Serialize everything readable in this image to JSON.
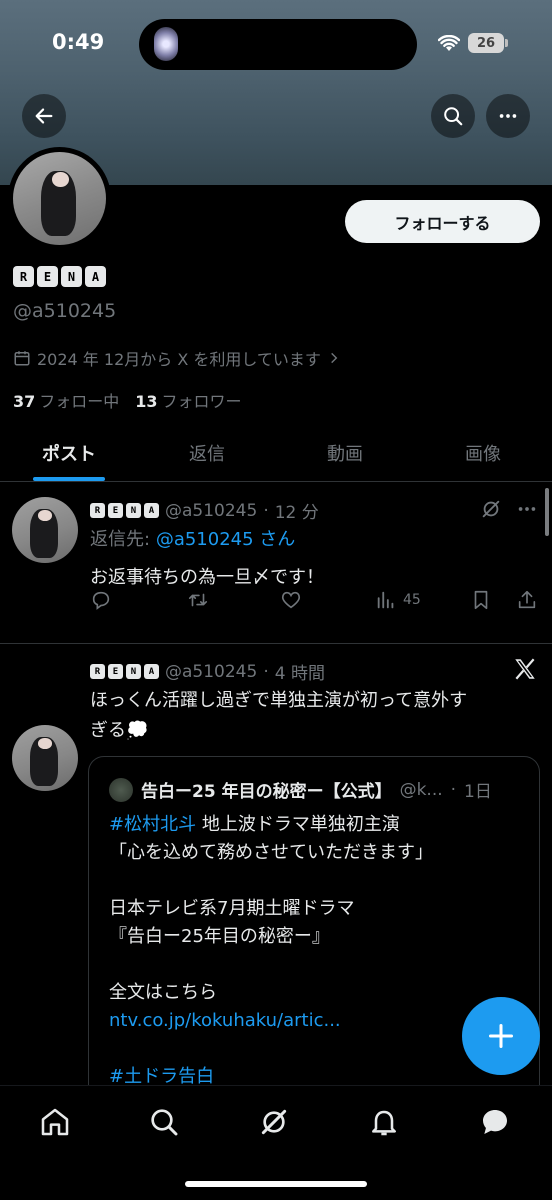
{
  "status": {
    "time": "0:49",
    "battery": "26"
  },
  "profile": {
    "name_tiles": [
      "R",
      "E",
      "N",
      "A"
    ],
    "handle": "@a510245",
    "joined": "2024 年 12月から X を利用しています",
    "following_count": "37",
    "following_label": "フォロー中",
    "followers_count": "13",
    "followers_label": "フォロワー",
    "follow_button": "フォローする"
  },
  "tabs": [
    {
      "label": "ポスト",
      "active": true
    },
    {
      "label": "返信"
    },
    {
      "label": "動画"
    },
    {
      "label": "画像"
    }
  ],
  "posts": [
    {
      "handle": "@a510245",
      "time": "12 分",
      "reply_prefix": "返信先:",
      "reply_to": "@a510245 さん",
      "text": "お返事待ちの為一旦〆です！",
      "views": "45"
    },
    {
      "handle": "@a510245",
      "time": "4 時間",
      "text_line1": "ほっくん活躍し過ぎで単独主演が初って意外す",
      "text_line2": "ぎる💭",
      "quote": {
        "name": "告白ー25 年目の秘密ー【公式】",
        "handle": "@k...",
        "time": "1日",
        "hashtag1": "#松村北斗",
        "line1_rest": " 地上波ドラマ単独初主演",
        "line2": "「心を込めて務めさせていただきます」",
        "line3": "日本テレビ系7月期土曜ドラマ",
        "line4": "『告白ー25年目の秘密ー』",
        "line5": "全文はこちら",
        "url": "ntv.co.jp/kokuhaku/artic...",
        "hashtag2": "#土ドラ告白"
      }
    }
  ],
  "colors": {
    "accent": "#1d9bf0",
    "muted": "#71767b",
    "text": "#e7e9ea",
    "bg": "#000000"
  }
}
